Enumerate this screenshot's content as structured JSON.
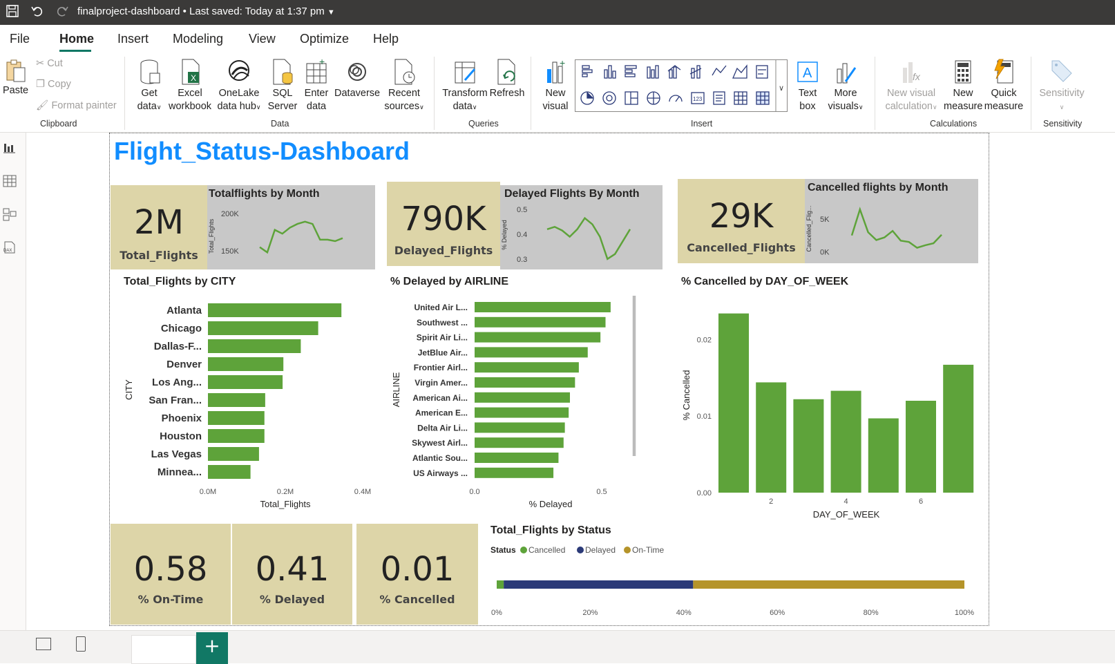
{
  "titlebar": {
    "doc_title": "finalproject-dashboard",
    "saved": "Last saved: Today at 1:37 pm"
  },
  "menu": {
    "items": [
      "File",
      "Home",
      "Insert",
      "Modeling",
      "View",
      "Optimize",
      "Help"
    ],
    "active": "Home"
  },
  "ribbon": {
    "clipboard": {
      "paste": "Paste",
      "cut": "Cut",
      "copy": "Copy",
      "format_painter": "Format painter",
      "group": "Clipboard"
    },
    "data": {
      "get_data": [
        "Get",
        "data"
      ],
      "excel": [
        "Excel",
        "workbook"
      ],
      "onelake": [
        "OneLake",
        "data hub"
      ],
      "sql": [
        "SQL",
        "Server"
      ],
      "enter": [
        "Enter",
        "data"
      ],
      "dataverse": [
        "Dataverse"
      ],
      "recent": [
        "Recent",
        "sources"
      ],
      "group": "Data"
    },
    "queries": {
      "transform": [
        "Transform",
        "data"
      ],
      "refresh": [
        "Refresh"
      ],
      "group": "Queries"
    },
    "insert": {
      "new_visual": [
        "New",
        "visual"
      ],
      "text_box": [
        "Text",
        "box"
      ],
      "more_visuals": [
        "More",
        "visuals"
      ],
      "group": "Insert"
    },
    "calculations": {
      "new_visual_calc": [
        "New visual",
        "calculation"
      ],
      "new_measure": [
        "New",
        "measure"
      ],
      "quick_measure": [
        "Quick",
        "measure"
      ],
      "group": "Calculations"
    },
    "sensitivity": {
      "label": "Sensitivity",
      "group": "Sensitivity"
    }
  },
  "dashboard": {
    "title": "Flight_Status-Dashboard",
    "kpis": {
      "total": {
        "value": "2M",
        "label": "Total_Flights"
      },
      "delayed": {
        "value": "790K",
        "label": "Delayed_Flights"
      },
      "cancelled": {
        "value": "29K",
        "label": "Cancelled_Flights"
      },
      "ontime_pct": {
        "value": "0.58",
        "label": "% On-Time"
      },
      "delayed_pct": {
        "value": "0.41",
        "label": "% Delayed"
      },
      "cancelled_pct": {
        "value": "0.01",
        "label": "% Cancelled"
      }
    },
    "accent_colors": {
      "bar": "#5ea33a",
      "kpi_bg": "#ddd5a8",
      "title": "#118dff",
      "delayed": "#2b3a78",
      "ontime": "#b5942a"
    }
  },
  "chart_data": [
    {
      "type": "line",
      "title": "Totalflights by Month",
      "ylabel": "Total_Flights",
      "yticks": [
        "200K",
        "150K"
      ],
      "ylim": [
        140000,
        210000
      ],
      "x": [
        1,
        2,
        3,
        4,
        5,
        6,
        7,
        8,
        9,
        10,
        11,
        12
      ],
      "values": [
        155000,
        148000,
        178000,
        173000,
        181000,
        186000,
        189000,
        186000,
        165000,
        165000,
        163000,
        167000
      ]
    },
    {
      "type": "line",
      "title": "Delayed Flights By Month",
      "ylabel": "% Delayed",
      "yticks": [
        "0.5",
        "0.4",
        "0.3"
      ],
      "ylim": [
        0.28,
        0.52
      ],
      "x": [
        1,
        2,
        3,
        4,
        5,
        6,
        7,
        8,
        9,
        10,
        11,
        12
      ],
      "values": [
        0.42,
        0.43,
        0.415,
        0.39,
        0.42,
        0.465,
        0.44,
        0.39,
        0.3,
        0.32,
        0.37,
        0.42
      ]
    },
    {
      "type": "line",
      "title": "Cancelled flights by Month",
      "ylabel": "Cancelled_Flig...",
      "yticks": [
        "5K",
        "0K"
      ],
      "ylim": [
        -500,
        8000
      ],
      "x": [
        1,
        2,
        3,
        4,
        5,
        6,
        7,
        8,
        9,
        10,
        11,
        12
      ],
      "values": [
        2500,
        6500,
        3000,
        1800,
        2200,
        3200,
        1700,
        1500,
        600,
        1000,
        1300,
        2600
      ]
    },
    {
      "type": "bar",
      "orientation": "horizontal",
      "title": "Total_Flights by CITY",
      "xlabel": "Total_Flights",
      "ylabel": "CITY",
      "categories": [
        "Atlanta",
        "Chicago",
        "Dallas-F...",
        "Denver",
        "Los Ang...",
        "San Fran...",
        "Phoenix",
        "Houston",
        "Las Vegas",
        "Minnea..."
      ],
      "values": [
        0.345,
        0.285,
        0.24,
        0.195,
        0.193,
        0.148,
        0.146,
        0.146,
        0.132,
        0.11
      ],
      "xticks": [
        "0.0M",
        "0.2M",
        "0.4M"
      ],
      "xlim": [
        0,
        0.4
      ]
    },
    {
      "type": "bar",
      "orientation": "horizontal",
      "title": "% Delayed by AIRLINE",
      "xlabel": "% Delayed",
      "ylabel": "AIRLINE",
      "categories": [
        "United Air L...",
        "Southwest ...",
        "Spirit Air Li...",
        "JetBlue Air...",
        "Frontier Airl...",
        "Virgin Amer...",
        "American Ai...",
        "American E...",
        "Delta Air Li...",
        "Skywest Airl...",
        "Atlantic Sou...",
        "US Airways ..."
      ],
      "values": [
        0.535,
        0.515,
        0.495,
        0.445,
        0.41,
        0.395,
        0.375,
        0.37,
        0.355,
        0.35,
        0.33,
        0.31
      ],
      "xticks": [
        "0.0",
        "0.5"
      ],
      "xlim": [
        0,
        0.5
      ]
    },
    {
      "type": "bar",
      "title": "% Cancelled by DAY_OF_WEEK",
      "xlabel": "DAY_OF_WEEK",
      "ylabel": "% Cancelled",
      "categories": [
        1,
        2,
        3,
        4,
        5,
        6,
        7
      ],
      "values": [
        0.0234,
        0.0144,
        0.0122,
        0.0133,
        0.0097,
        0.012,
        0.0167
      ],
      "xticks": [
        "2",
        "4",
        "6"
      ],
      "yticks": [
        "0.02",
        "0.01",
        "0.00"
      ],
      "ylim": [
        0,
        0.024
      ]
    },
    {
      "type": "bar",
      "orientation": "stacked-100",
      "title": "Total_Flights by Status",
      "legend_title": "Status",
      "series": [
        {
          "name": "Cancelled",
          "value": 0.015,
          "color": "#5ea33a"
        },
        {
          "name": "Delayed",
          "value": 0.405,
          "color": "#2b3a78"
        },
        {
          "name": "On-Time",
          "value": 0.58,
          "color": "#b5942a"
        }
      ],
      "xticks": [
        "0%",
        "20%",
        "40%",
        "60%",
        "80%",
        "100%"
      ]
    }
  ]
}
